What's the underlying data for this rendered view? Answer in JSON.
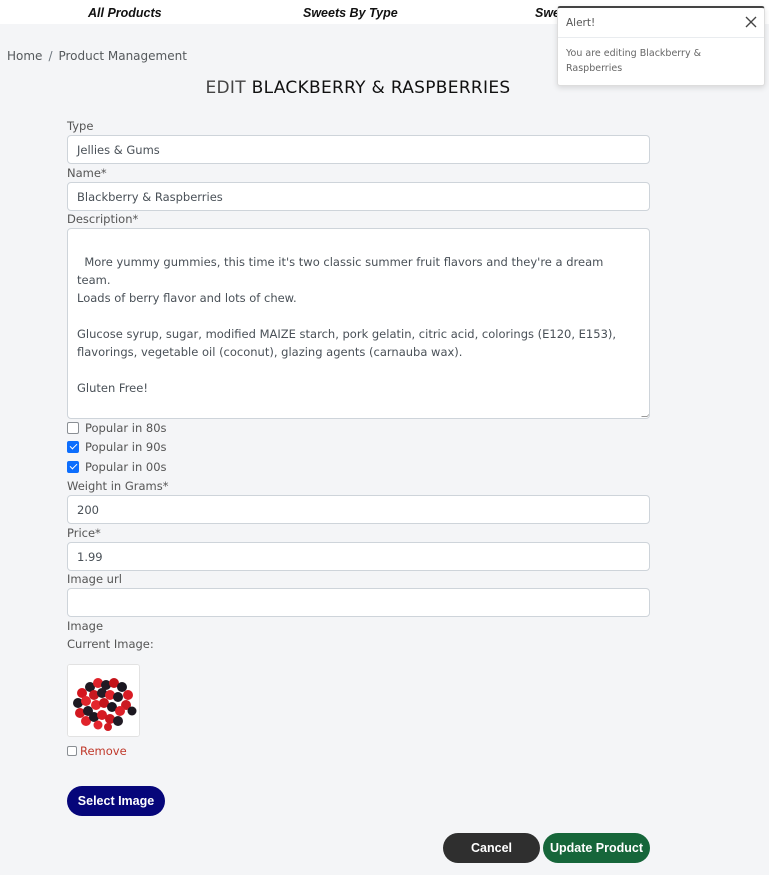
{
  "nav": {
    "items": [
      "All Products",
      "Sweets By Type",
      "Swe"
    ]
  },
  "breadcrumb": {
    "home": "Home",
    "separator": "/",
    "current": "Product Management"
  },
  "page": {
    "title_prefix": "EDIT",
    "title_name": "BLACKBERRY & RASPBERRIES"
  },
  "form": {
    "type_label": "Type",
    "type_value": "Jellies & Gums",
    "name_label": "Name*",
    "name_value": "Blackberry & Raspberries",
    "description_label": "Description*",
    "description_value": "More yummy gummies, this time it's two classic summer fruit flavors and they're a dream team.\nLoads of berry flavor and lots of chew.\n\nGlucose syrup, sugar, modified MAIZE starch, pork gelatin, citric acid, colorings (E120, E153),\nflavorings, vegetable oil (coconut), glazing agents (carnauba wax).\n\nGluten Free!",
    "checkboxes": [
      {
        "label": "Popular in 80s",
        "checked": false
      },
      {
        "label": "Popular in 90s",
        "checked": true
      },
      {
        "label": "Popular in 00s",
        "checked": true
      }
    ],
    "weight_label": "Weight in Grams*",
    "weight_value": "200",
    "price_label": "Price*",
    "price_value": "1.99",
    "image_url_label": "Image url",
    "image_url_value": "",
    "image_label": "Image",
    "current_image_label": "Current Image:",
    "remove_label": "Remove",
    "select_image_button": "Select Image",
    "cancel_button": "Cancel",
    "update_button": "Update Product"
  },
  "toast": {
    "header": "Alert!",
    "body": "You are editing Blackberry & Raspberries"
  },
  "colors": {
    "select_button": "#06067a",
    "cancel_button": "#2f2f2f",
    "update_button": "#16663a",
    "checkbox_checked": "#0d6efd",
    "remove_text": "#c0392b"
  }
}
